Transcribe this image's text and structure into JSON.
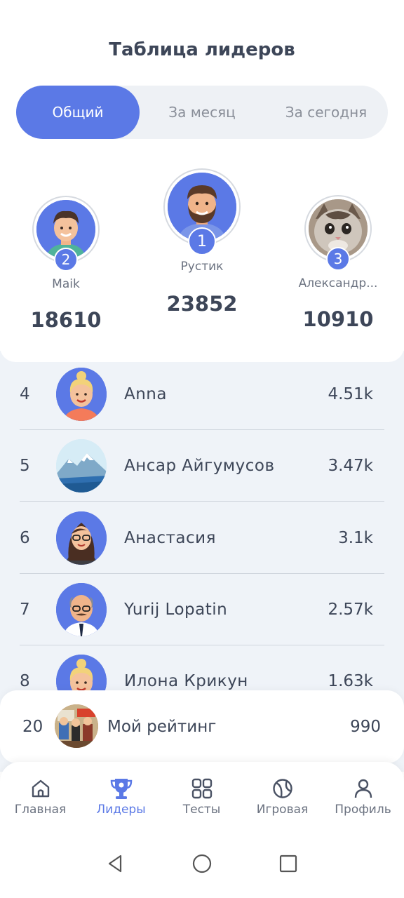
{
  "header": {
    "title": "Таблица лидеров"
  },
  "tabs": [
    {
      "label": "Общий",
      "active": true
    },
    {
      "label": "За месяц",
      "active": false
    },
    {
      "label": "За сегодня",
      "active": false
    }
  ],
  "podium": {
    "first": {
      "rank": "1",
      "name": "Рустик",
      "score": "23852",
      "avatar": "bearded-man-avatar"
    },
    "second": {
      "rank": "2",
      "name": "Maik",
      "score": "18610",
      "avatar": "young-man-avatar"
    },
    "third": {
      "rank": "3",
      "name": "Александр...",
      "score": "10910",
      "avatar": "cat-photo-avatar"
    }
  },
  "leaders": [
    {
      "rank": "4",
      "name": "Anna",
      "score": "4.51k",
      "avatar": "blonde-woman-avatar"
    },
    {
      "rank": "5",
      "name": "Ансар Айгумусов",
      "score": "3.47k",
      "avatar": "mountain-photo-avatar"
    },
    {
      "rank": "6",
      "name": "Анастасия",
      "score": "3.1k",
      "avatar": "woman-glasses-avatar"
    },
    {
      "rank": "7",
      "name": "Yurij Lopatin",
      "score": "2.57k",
      "avatar": "bald-man-avatar"
    },
    {
      "rank": "8",
      "name": "Илона Крикун",
      "score": "1.63k",
      "avatar": "blonde-woman-avatar"
    }
  ],
  "my_rating": {
    "rank": "20",
    "label": "Мой рейтинг",
    "score": "990",
    "avatar": "cartoon-photo-avatar"
  },
  "nav": [
    {
      "label": "Главная",
      "icon": "home-icon",
      "active": false
    },
    {
      "label": "Лидеры",
      "icon": "trophy-icon",
      "active": true
    },
    {
      "label": "Тесты",
      "icon": "grid-icon",
      "active": false
    },
    {
      "label": "Игровая",
      "icon": "ball-icon",
      "active": false
    },
    {
      "label": "Профиль",
      "icon": "user-icon",
      "active": false
    }
  ],
  "colors": {
    "accent": "#5b79e6",
    "list_background": "#eff3f8",
    "text": "#3d4658",
    "muted": "#8a8f99"
  }
}
